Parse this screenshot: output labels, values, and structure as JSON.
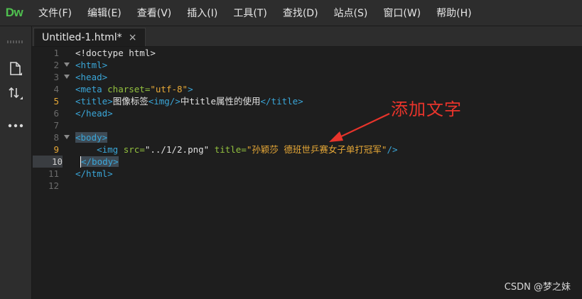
{
  "app": {
    "logo": "Dw"
  },
  "menu": [
    "文件(F)",
    "编辑(E)",
    "查看(V)",
    "插入(I)",
    "工具(T)",
    "查找(D)",
    "站点(S)",
    "窗口(W)",
    "帮助(H)"
  ],
  "tab": {
    "title": "Untitled-1.html*",
    "close": "×"
  },
  "line_numbers": [
    "1",
    "2",
    "3",
    "4",
    "5",
    "6",
    "7",
    "8",
    "9",
    "10",
    "11",
    "12"
  ],
  "code": {
    "l1": "<!doctype html>",
    "l2": "<html>",
    "l3": "<head>",
    "l4_tag_open": "<meta ",
    "l4_attr": "charset=",
    "l4_val": "\"utf-8\"",
    "l4_tag_close": ">",
    "l5_tag1": "<title>",
    "l5_txt1": "图像标签",
    "l5_tag2": "<img/>",
    "l5_txt2": "中title属性的使用",
    "l5_tag3": "</title>",
    "l6": "</head>",
    "l8": "<body>",
    "l9_indent": "    ",
    "l9_tag_open": "<img ",
    "l9_attr1": "src=",
    "l9_val1": "\"../1/2.png\"",
    "l9_attr2": " title=",
    "l9_val2": "\"孙颖莎 德班世乒赛女子单打冠军\"",
    "l9_tag_close": "/>",
    "l10": "</body>",
    "l11": "</html>"
  },
  "annotation": {
    "text": "添加文字",
    "color": "#e8342b"
  },
  "watermark": "CSDN @梦之妹",
  "colors": {
    "tag": "#3aa6d8",
    "attr": "#93c13f",
    "value": "#e8a937",
    "logo": "#4fc04f"
  },
  "icons": [
    "new-file-icon",
    "sort-icon",
    "more-icon",
    "fold-arrow-icon",
    "close-icon"
  ]
}
